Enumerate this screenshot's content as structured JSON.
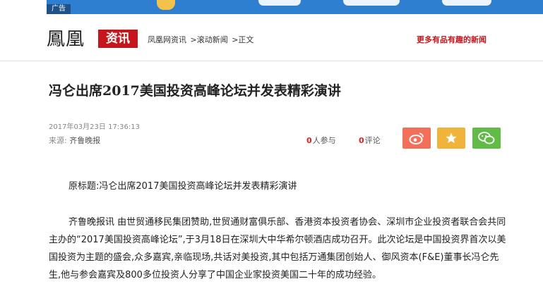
{
  "ad": {
    "badge": "广告"
  },
  "header": {
    "logo_wordmark": "鳳凰",
    "logo_box": "资讯",
    "breadcrumb": [
      "凤凰网资讯",
      ">滚动新闻",
      ">正文"
    ],
    "tagline": "更多有品有趣的新闻"
  },
  "article": {
    "title": "冯仑出席2017美国投资高峰论坛并发表精彩演讲",
    "timestamp": "2017年03月23日 17:36:13",
    "source_label": "来源:",
    "source_value": "齐鲁晚报",
    "participants_count": "0",
    "participants_label": "人参与",
    "comments_count": "0",
    "comments_label": "评论",
    "original_title": "原标题:冯仑出席2017美国投资高峰论坛并发表精彩演讲",
    "body": "齐鲁晚报讯 由世贸通移民集团赞助,世贸通财富俱乐部、香港资本投资者协会、深圳市企业投资者联合会共同主办的“2017美国投资高峰论坛”,于3月18日在深圳大中华希尔顿酒店成功召开。此次论坛是中国投资界首次以美国投资为主题的盛会,众多嘉宾,亲临现场,共话对美投资,其中包括万通集团创始人、御风资本(F&E)董事长冯仑先生,他与参会嘉宾及800多位投资人分享了中国企业家投资美国二十年的成功经验。"
  },
  "share": {
    "weibo_icon": "weibo-icon",
    "favorite_icon": "star-icon",
    "wechat_icon": "wechat-icon"
  },
  "colors": {
    "brand_red": "#c4161c",
    "weibo": "#f2705a",
    "favorite": "#f0b43a",
    "wechat": "#62bb47"
  }
}
